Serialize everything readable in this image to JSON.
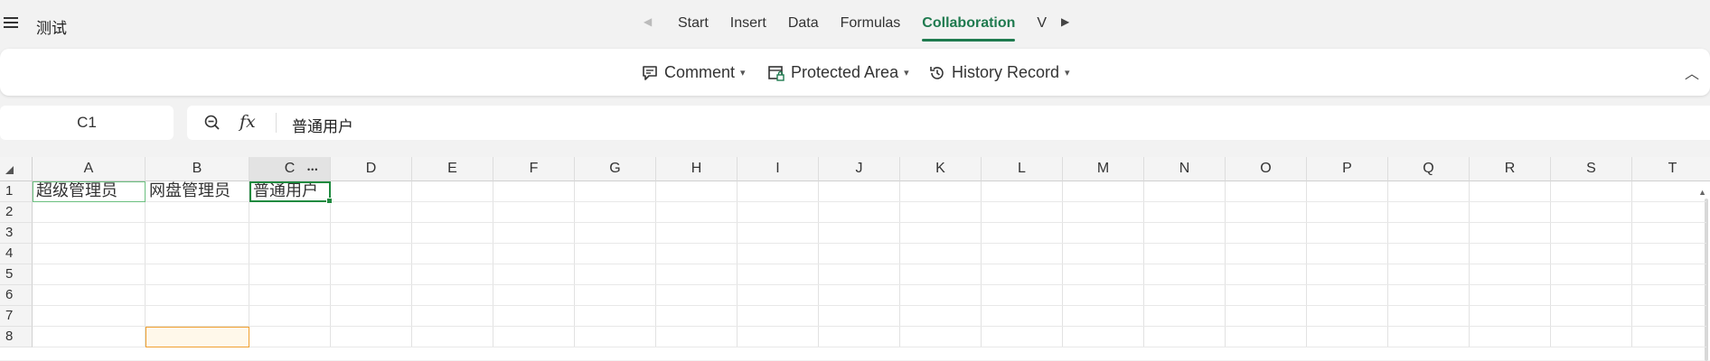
{
  "app": {
    "doc_title": "测试"
  },
  "tabs": [
    {
      "label": "Start",
      "active": false
    },
    {
      "label": "Insert",
      "active": false
    },
    {
      "label": "Data",
      "active": false
    },
    {
      "label": "Formulas",
      "active": false
    },
    {
      "label": "Collaboration",
      "active": true
    },
    {
      "label": "V",
      "active": false
    }
  ],
  "ribbon": {
    "comment_label": "Comment",
    "protected_label": "Protected Area",
    "history_label": "History Record"
  },
  "formula": {
    "name_box": "C1",
    "value": "普通用户"
  },
  "columns": [
    "A",
    "B",
    "C",
    "D",
    "E",
    "F",
    "G",
    "H",
    "I",
    "J",
    "K",
    "L",
    "M",
    "N",
    "O",
    "P",
    "Q",
    "R",
    "S",
    "T"
  ],
  "rows": [
    "1",
    "2",
    "3",
    "4",
    "5",
    "6",
    "7",
    "8"
  ],
  "cells": {
    "A1": "超级管理员",
    "B1": "网盘管理员",
    "C1": "普通用户"
  },
  "selection": {
    "active_cell": "C1",
    "highlight_cell": "B8"
  },
  "colors": {
    "accent": "#1f7a4f",
    "selection": "#1f8a3f",
    "highlight": "#f0a030"
  }
}
